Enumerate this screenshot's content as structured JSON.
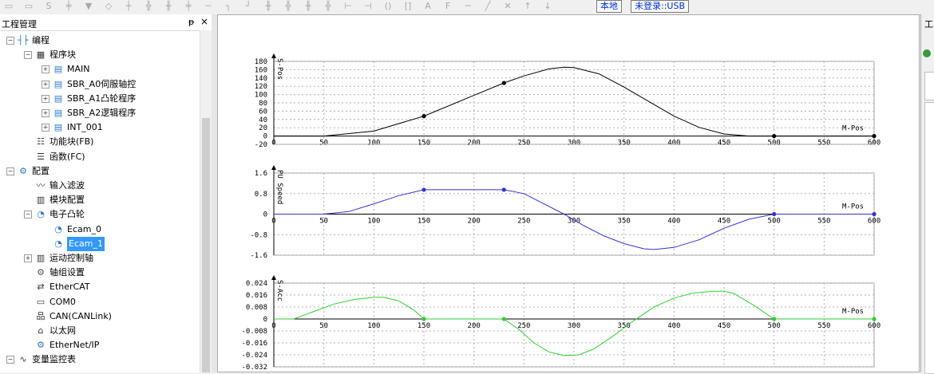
{
  "toolbar": {
    "button_local": "本地",
    "button_login": "未登录::USB",
    "icons": [
      "ld-icon",
      "ldn-icon",
      "s-icon",
      "contact-no-icon",
      "contact-nc-icon",
      "coil-icon",
      "rung-icon",
      "branch-icon",
      "branch-open-icon",
      "branch-close-icon",
      "line-icon",
      "wire-icon",
      "wire2-icon",
      "parallel-icon",
      "parallel2-icon",
      "series-icon",
      "series2-icon",
      "pos-icon",
      "neg-icon",
      "box-icon",
      "bracket-icon",
      "ab-icon",
      "fb-icon",
      "hline-icon",
      "slash-icon",
      "cross-icon",
      "up-icon",
      "down-icon"
    ]
  },
  "panel": {
    "title": "工程管理",
    "pin": "ᵽ",
    "close": "×"
  },
  "tree": [
    {
      "label": "编程",
      "icon": "program-icon",
      "exp": "−",
      "name": "tree-programming"
    },
    {
      "label": "程序块",
      "icon": "program-block-icon",
      "exp": "−",
      "name": "tree-program-blocks"
    },
    {
      "label": "MAIN",
      "icon": "pou-m-icon",
      "exp": "+",
      "name": "tree-main"
    },
    {
      "label": "SBR_A0伺服轴控",
      "icon": "pou-s-icon",
      "exp": "+",
      "name": "tree-sbr-a0"
    },
    {
      "label": "SBR_A1凸轮程序",
      "icon": "pou-s-icon",
      "exp": "+",
      "name": "tree-sbr-a1"
    },
    {
      "label": "SBR_A2逻辑程序",
      "icon": "pou-s-icon",
      "exp": "+",
      "name": "tree-sbr-a2"
    },
    {
      "label": "INT_001",
      "icon": "pou-i-icon",
      "exp": "+",
      "name": "tree-int-001"
    },
    {
      "label": "功能块(FB)",
      "icon": "function-block-icon",
      "exp": "",
      "name": "tree-fb"
    },
    {
      "label": "函数(FC)",
      "icon": "function-icon",
      "exp": "",
      "name": "tree-fc"
    },
    {
      "label": "配置",
      "icon": "config-icon",
      "exp": "−",
      "name": "tree-config"
    },
    {
      "label": "输入滤波",
      "icon": "filter-icon",
      "exp": "",
      "name": "tree-input-filter"
    },
    {
      "label": "模块配置",
      "icon": "module-icon",
      "exp": "",
      "name": "tree-module-config"
    },
    {
      "label": "电子凸轮",
      "icon": "cam-icon",
      "exp": "−",
      "name": "tree-ecam"
    },
    {
      "label": "Ecam_0",
      "icon": "cam-icon",
      "exp": "",
      "name": "tree-ecam-0"
    },
    {
      "label": "Ecam_1",
      "icon": "cam-icon",
      "exp": "",
      "name": "tree-ecam-1",
      "selected": true
    },
    {
      "label": "运动控制轴",
      "icon": "axis-icon",
      "exp": "+",
      "name": "tree-motion-axes"
    },
    {
      "label": "轴组设置",
      "icon": "gear-icon",
      "exp": "",
      "name": "tree-axis-group"
    },
    {
      "label": "EtherCAT",
      "icon": "ethercat-icon",
      "exp": "",
      "name": "tree-ethercat"
    },
    {
      "label": "COM0",
      "icon": "serial-port-icon",
      "exp": "",
      "name": "tree-com0"
    },
    {
      "label": "CAN(CANLink)",
      "icon": "network-icon",
      "exp": "",
      "name": "tree-can"
    },
    {
      "label": "以太网",
      "icon": "ethernet-icon",
      "exp": "",
      "name": "tree-ethernet"
    },
    {
      "label": "EtherNet/IP",
      "icon": "config-icon",
      "exp": "",
      "name": "tree-ethernet-ip"
    },
    {
      "label": "变量监控表",
      "icon": "monitor-icon",
      "exp": "−",
      "name": "tree-var-monitor"
    }
  ],
  "right_panel": {
    "title": "工"
  },
  "chart_data": [
    {
      "type": "line",
      "name": "position",
      "ylabel": "S-Pos",
      "xlabel": "M-Pos",
      "xlim": [
        0,
        600
      ],
      "ylim": [
        -20,
        180
      ],
      "xticks": [
        0,
        50,
        100,
        150,
        200,
        250,
        300,
        350,
        400,
        450,
        500,
        550,
        600
      ],
      "yticks": [
        180,
        160,
        140,
        120,
        100,
        80,
        60,
        40,
        20,
        0,
        -20
      ],
      "grid": true,
      "color": "#000000",
      "x": [
        0,
        50,
        100,
        150,
        200,
        230,
        250,
        275,
        290,
        300,
        325,
        350,
        375,
        400,
        425,
        450,
        475,
        500,
        550,
        600
      ],
      "y": [
        0,
        0,
        12,
        48,
        98,
        128,
        145,
        162,
        166,
        165,
        150,
        118,
        83,
        48,
        21,
        5,
        0,
        0,
        0,
        0
      ],
      "points": [
        [
          150,
          48
        ],
        [
          230,
          128
        ],
        [
          500,
          0
        ],
        [
          600,
          0
        ]
      ]
    },
    {
      "type": "line",
      "name": "speed",
      "ylabel": "PU Speed",
      "xlabel": "M-Pos",
      "xlim": [
        0,
        600
      ],
      "ylim": [
        -1.6,
        1.6
      ],
      "xticks": [
        0,
        50,
        100,
        150,
        200,
        250,
        300,
        350,
        400,
        450,
        500,
        550,
        600
      ],
      "yticks": [
        1.6,
        0.8,
        0,
        -0.8,
        -1.6
      ],
      "grid": true,
      "color": "#3333cc",
      "x": [
        0,
        50,
        75,
        100,
        125,
        150,
        200,
        230,
        250,
        270,
        290,
        310,
        330,
        350,
        370,
        380,
        400,
        425,
        450,
        475,
        500,
        550,
        600
      ],
      "y": [
        0,
        0,
        0.1,
        0.4,
        0.72,
        0.95,
        0.95,
        0.95,
        0.8,
        0.4,
        0,
        -0.45,
        -0.85,
        -1.15,
        -1.35,
        -1.38,
        -1.3,
        -1.0,
        -0.55,
        -0.2,
        0,
        0,
        0
      ],
      "points": [
        [
          150,
          0.95
        ],
        [
          230,
          0.95
        ],
        [
          500,
          0
        ],
        [
          600,
          0
        ]
      ]
    },
    {
      "type": "line",
      "name": "acceleration",
      "ylabel": "S-Acc",
      "xlabel": "M-Pos",
      "xlim": [
        0,
        600
      ],
      "ylim": [
        -0.032,
        0.024
      ],
      "xticks": [
        0,
        50,
        100,
        150,
        200,
        250,
        300,
        350,
        400,
        450,
        500,
        550,
        600
      ],
      "yticks": [
        0.024,
        0.016,
        0.008,
        0,
        -0.008,
        -0.016,
        -0.024,
        -0.032
      ],
      "grid": true,
      "color": "#33cc33",
      "x": [
        0,
        20,
        40,
        60,
        80,
        100,
        110,
        125,
        140,
        150,
        200,
        230,
        245,
        260,
        275,
        290,
        305,
        320,
        340,
        360,
        380,
        400,
        420,
        440,
        450,
        460,
        480,
        500,
        550,
        600
      ],
      "y": [
        0,
        0,
        0.005,
        0.01,
        0.013,
        0.0145,
        0.0145,
        0.012,
        0.006,
        0,
        0,
        0,
        -0.007,
        -0.016,
        -0.022,
        -0.0245,
        -0.024,
        -0.02,
        -0.011,
        -0.001,
        0.008,
        0.014,
        0.0175,
        0.0185,
        0.0185,
        0.017,
        0.009,
        0,
        0,
        0
      ],
      "points": [
        [
          150,
          0
        ],
        [
          230,
          0
        ],
        [
          500,
          0
        ],
        [
          600,
          0
        ]
      ]
    }
  ]
}
